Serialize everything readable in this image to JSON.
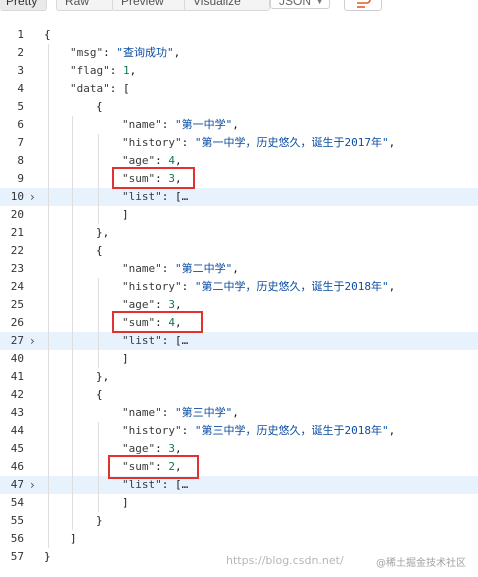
{
  "toolbar": {
    "tabs": [
      {
        "label": "Pretty"
      },
      {
        "label": "Raw"
      },
      {
        "label": "Preview"
      },
      {
        "label": "Visualize"
      }
    ],
    "format": "JSON",
    "wrap_icon": "wrap-lines-icon"
  },
  "editor": {
    "lines": [
      {
        "n": "1",
        "indent": 0,
        "parts": [
          {
            "t": "{",
            "c": "p"
          }
        ]
      },
      {
        "n": "2",
        "indent": 1,
        "parts": [
          {
            "t": "\"msg\"",
            "c": "k"
          },
          {
            "t": ": ",
            "c": "p"
          },
          {
            "t": "\"查询成功\"",
            "c": "s"
          },
          {
            "t": ",",
            "c": "p"
          }
        ]
      },
      {
        "n": "3",
        "indent": 1,
        "parts": [
          {
            "t": "\"flag\"",
            "c": "k"
          },
          {
            "t": ": ",
            "c": "p"
          },
          {
            "t": "1",
            "c": "n"
          },
          {
            "t": ",",
            "c": "p"
          }
        ]
      },
      {
        "n": "4",
        "indent": 1,
        "parts": [
          {
            "t": "\"data\"",
            "c": "k"
          },
          {
            "t": ": [",
            "c": "p"
          }
        ]
      },
      {
        "n": "5",
        "indent": 2,
        "parts": [
          {
            "t": "{",
            "c": "p"
          }
        ]
      },
      {
        "n": "6",
        "indent": 3,
        "parts": [
          {
            "t": "\"name\"",
            "c": "k"
          },
          {
            "t": ": ",
            "c": "p"
          },
          {
            "t": "\"第一中学\"",
            "c": "s"
          },
          {
            "t": ",",
            "c": "p"
          }
        ]
      },
      {
        "n": "7",
        "indent": 3,
        "parts": [
          {
            "t": "\"history\"",
            "c": "k"
          },
          {
            "t": ": ",
            "c": "p"
          },
          {
            "t": "\"第一中学，历史悠久，诞生于2017年\"",
            "c": "s"
          },
          {
            "t": ",",
            "c": "p"
          }
        ]
      },
      {
        "n": "8",
        "indent": 3,
        "parts": [
          {
            "t": "\"age\"",
            "c": "k"
          },
          {
            "t": ": ",
            "c": "p"
          },
          {
            "t": "4",
            "c": "n"
          },
          {
            "t": ",",
            "c": "p"
          }
        ]
      },
      {
        "n": "9",
        "indent": 3,
        "parts": [
          {
            "t": "\"sum\"",
            "c": "k"
          },
          {
            "t": ": ",
            "c": "p"
          },
          {
            "t": "3",
            "c": "n"
          },
          {
            "t": ",",
            "c": "p"
          }
        ]
      },
      {
        "n": "10",
        "indent": 3,
        "fold": true,
        "hl": true,
        "parts": [
          {
            "t": "\"list\"",
            "c": "k"
          },
          {
            "t": ": [",
            "c": "p"
          },
          {
            "t": "…",
            "c": "p"
          }
        ]
      },
      {
        "n": "20",
        "indent": 3,
        "parts": [
          {
            "t": "]",
            "c": "p"
          }
        ]
      },
      {
        "n": "21",
        "indent": 2,
        "parts": [
          {
            "t": "},",
            "c": "p"
          }
        ]
      },
      {
        "n": "22",
        "indent": 2,
        "parts": [
          {
            "t": "{",
            "c": "p"
          }
        ]
      },
      {
        "n": "23",
        "indent": 3,
        "parts": [
          {
            "t": "\"name\"",
            "c": "k"
          },
          {
            "t": ": ",
            "c": "p"
          },
          {
            "t": "\"第二中学\"",
            "c": "s"
          },
          {
            "t": ",",
            "c": "p"
          }
        ]
      },
      {
        "n": "24",
        "indent": 3,
        "parts": [
          {
            "t": "\"history\"",
            "c": "k"
          },
          {
            "t": ": ",
            "c": "p"
          },
          {
            "t": "\"第二中学，历史悠久，诞生于2018年\"",
            "c": "s"
          },
          {
            "t": ",",
            "c": "p"
          }
        ]
      },
      {
        "n": "25",
        "indent": 3,
        "parts": [
          {
            "t": "\"age\"",
            "c": "k"
          },
          {
            "t": ": ",
            "c": "p"
          },
          {
            "t": "3",
            "c": "n"
          },
          {
            "t": ",",
            "c": "p"
          }
        ]
      },
      {
        "n": "26",
        "indent": 3,
        "parts": [
          {
            "t": "\"sum\"",
            "c": "k"
          },
          {
            "t": ": ",
            "c": "p"
          },
          {
            "t": "4",
            "c": "n"
          },
          {
            "t": ",",
            "c": "p"
          }
        ]
      },
      {
        "n": "27",
        "indent": 3,
        "fold": true,
        "hl": true,
        "parts": [
          {
            "t": "\"list\"",
            "c": "k"
          },
          {
            "t": ": [",
            "c": "p"
          },
          {
            "t": "…",
            "c": "p"
          }
        ]
      },
      {
        "n": "40",
        "indent": 3,
        "parts": [
          {
            "t": "]",
            "c": "p"
          }
        ]
      },
      {
        "n": "41",
        "indent": 2,
        "parts": [
          {
            "t": "},",
            "c": "p"
          }
        ]
      },
      {
        "n": "42",
        "indent": 2,
        "parts": [
          {
            "t": "{",
            "c": "p"
          }
        ]
      },
      {
        "n": "43",
        "indent": 3,
        "parts": [
          {
            "t": "\"name\"",
            "c": "k"
          },
          {
            "t": ": ",
            "c": "p"
          },
          {
            "t": "\"第三中学\"",
            "c": "s"
          },
          {
            "t": ",",
            "c": "p"
          }
        ]
      },
      {
        "n": "44",
        "indent": 3,
        "parts": [
          {
            "t": "\"history\"",
            "c": "k"
          },
          {
            "t": ": ",
            "c": "p"
          },
          {
            "t": "\"第三中学，历史悠久，诞生于2018年\"",
            "c": "s"
          },
          {
            "t": ",",
            "c": "p"
          }
        ]
      },
      {
        "n": "45",
        "indent": 3,
        "parts": [
          {
            "t": "\"age\"",
            "c": "k"
          },
          {
            "t": ": ",
            "c": "p"
          },
          {
            "t": "3",
            "c": "n"
          },
          {
            "t": ",",
            "c": "p"
          }
        ]
      },
      {
        "n": "46",
        "indent": 3,
        "parts": [
          {
            "t": "\"sum\"",
            "c": "k"
          },
          {
            "t": ": ",
            "c": "p"
          },
          {
            "t": "2",
            "c": "n"
          },
          {
            "t": ",",
            "c": "p"
          }
        ]
      },
      {
        "n": "47",
        "indent": 3,
        "fold": true,
        "hl": true,
        "parts": [
          {
            "t": "\"list\"",
            "c": "k"
          },
          {
            "t": ": [",
            "c": "p"
          },
          {
            "t": "…",
            "c": "p"
          }
        ]
      },
      {
        "n": "54",
        "indent": 3,
        "parts": [
          {
            "t": "]",
            "c": "p"
          }
        ]
      },
      {
        "n": "55",
        "indent": 2,
        "parts": [
          {
            "t": "}",
            "c": "p"
          }
        ]
      },
      {
        "n": "56",
        "indent": 1,
        "parts": [
          {
            "t": "]",
            "c": "p"
          }
        ]
      },
      {
        "n": "57",
        "indent": 0,
        "parts": [
          {
            "t": "}",
            "c": "p"
          }
        ]
      }
    ],
    "highlighted_lines": [
      "9",
      "26",
      "46"
    ]
  },
  "watermark": {
    "url": "https://blog.csdn.net/",
    "brand": "@稀土掘金技术社区"
  },
  "colors": {
    "key": "#3a3a3a",
    "string": "#0c4da2",
    "number": "#0a7a5a",
    "highlight_row": "#e8f2fc",
    "annotation_box": "#e23131"
  }
}
